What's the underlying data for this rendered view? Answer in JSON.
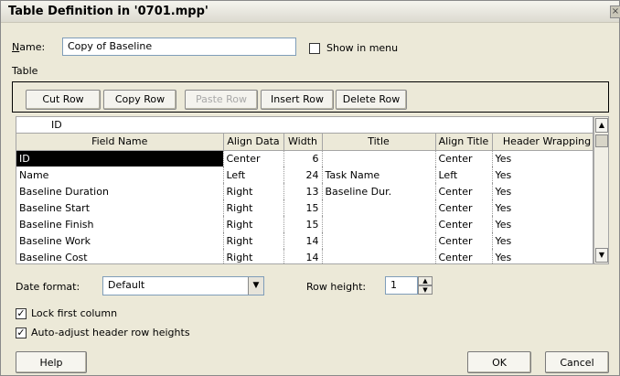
{
  "dialog": {
    "title": "Table Definition in '0701.mpp'",
    "close_glyph": "×"
  },
  "name_field": {
    "label": "Name:",
    "value": "Copy of Baseline"
  },
  "show_in_menu": {
    "label": "Show in menu",
    "checked": false
  },
  "table_section": {
    "label": "Table"
  },
  "toolbar": {
    "cut_row": "Cut Row",
    "copy_row": "Copy Row",
    "paste_row": "Paste Row",
    "insert_row": "Insert Row",
    "delete_row": "Delete Row"
  },
  "edit_value": "ID",
  "grid": {
    "columns": [
      "Field Name",
      "Align Data",
      "Width",
      "Title",
      "Align Title",
      "Header Wrapping"
    ],
    "rows": [
      [
        "ID",
        "Center",
        "6",
        "",
        "Center",
        "Yes"
      ],
      [
        "Name",
        "Left",
        "24",
        "Task Name",
        "Left",
        "Yes"
      ],
      [
        "Baseline Duration",
        "Right",
        "13",
        "Baseline Dur.",
        "Center",
        "Yes"
      ],
      [
        "Baseline Start",
        "Right",
        "15",
        "",
        "Center",
        "Yes"
      ],
      [
        "Baseline Finish",
        "Right",
        "15",
        "",
        "Center",
        "Yes"
      ],
      [
        "Baseline Work",
        "Right",
        "14",
        "",
        "Center",
        "Yes"
      ],
      [
        "Baseline Cost",
        "Right",
        "14",
        "",
        "Center",
        "Yes"
      ]
    ]
  },
  "date_format": {
    "label": "Date format:",
    "value": "Default"
  },
  "row_height": {
    "label": "Row height:",
    "value": "1"
  },
  "lock_first_column": {
    "label": "Lock first column",
    "checked": true
  },
  "auto_adjust": {
    "label": "Auto-adjust header row heights",
    "checked": true
  },
  "buttons": {
    "help": "Help",
    "ok": "OK",
    "cancel": "Cancel"
  }
}
